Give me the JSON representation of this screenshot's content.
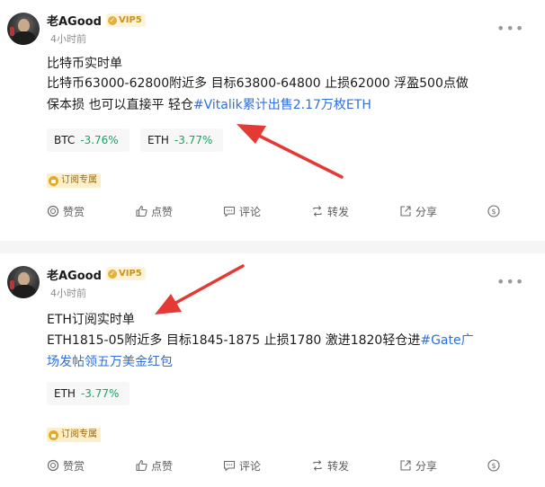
{
  "posts": [
    {
      "username": "老AGood",
      "vip": "VIP5",
      "time": "4小时前",
      "title": "比特币实时单",
      "content_line1": "比特币63000-62800附近多 目标63800-64800 止损62000 浮盈500点做",
      "content_line2_prefix": "保本损 也可以直接平 轻仓",
      "hashtag": "#Vitalik累计出售2.17万枚ETH",
      "tickers": [
        {
          "symbol": "BTC",
          "change": "-3.76%"
        },
        {
          "symbol": "ETH",
          "change": "-3.77%"
        }
      ],
      "badge": "订阅专属",
      "actions": {
        "tip": "赞赏",
        "like": "点赞",
        "comment": "评论",
        "repost": "转发",
        "share": "分享"
      }
    },
    {
      "username": "老AGood",
      "vip": "VIP5",
      "time": "4小时前",
      "title": "ETH订阅实时单",
      "content_line1_prefix": "ETH1815-05附近多 目标1845-1875 止损1780 激进1820轻仓进",
      "hashtag_part1": "#Gate广",
      "hashtag_part2": "场发帖领五万美金红包",
      "tickers": [
        {
          "symbol": "ETH",
          "change": "-3.77%"
        }
      ],
      "badge": "订阅专属",
      "actions": {
        "tip": "赞赏",
        "like": "点赞",
        "comment": "评论",
        "repost": "转发",
        "share": "分享"
      }
    }
  ],
  "colors": {
    "hashtag": "#2f6fe0",
    "negative_change": "#1aa363",
    "arrow": "#e53935",
    "vip": "#c79318"
  }
}
